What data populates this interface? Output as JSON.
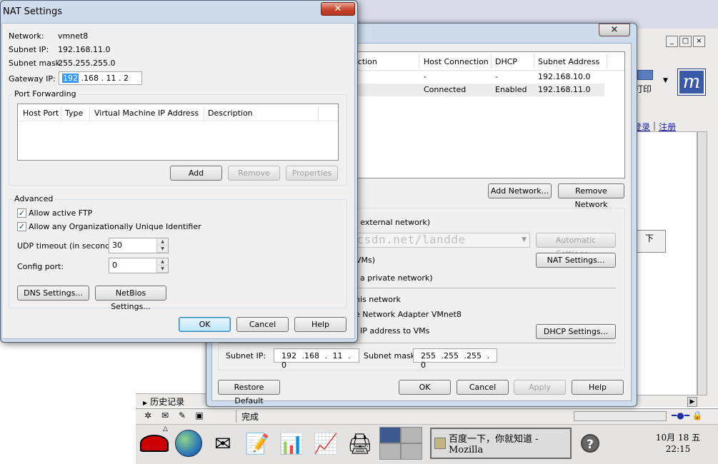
{
  "desktop": {
    "window_controls": [
      "_",
      "□",
      "×"
    ],
    "print_label": "打印",
    "right_links": [
      "登录",
      "注册"
    ],
    "box_text": "下",
    "history_label": "历史记录",
    "status_text": "完成",
    "taskbar_task": "百度一下，你就知道 - Mozilla",
    "clock_date": "10月 18 五",
    "clock_time": "22:15",
    "help_icon": "?"
  },
  "network_editor": {
    "close_glyph": "×",
    "columns": [
      "ection",
      "Host Connection",
      "DHCP",
      "Subnet Address"
    ],
    "rows": [
      {
        "host_connection": "-",
        "dhcp": "-",
        "subnet": "192.168.10.0"
      },
      {
        "host_connection": "Connected",
        "dhcp": "Enabled",
        "subnet": "192.168.11.0"
      }
    ],
    "add_network": "Add Network...",
    "remove_network": "Remove Network",
    "bridged_text": "e external network)",
    "automatic_settings": "Automatic Settings...",
    "nat_text": "VMs)",
    "nat_settings": "NAT Settings...",
    "host_only_text": "a private network)",
    "connect_adapter_text": "his network",
    "adapter_name_text": "e Network Adapter VMnet8",
    "dhcp_text": "IP address to VMs",
    "dhcp_settings": "DHCP Settings...",
    "subnet_ip_label": "Subnet IP:",
    "subnet_ip_value": "192 .168 . 11 . 0",
    "subnet_mask_label": "Subnet mask:",
    "subnet_mask_value": "255 .255 .255 . 0",
    "restore_default": "Restore Default",
    "ok": "OK",
    "cancel": "Cancel",
    "apply": "Apply",
    "help": "Help"
  },
  "watermark": "http://blog.csdn.net/landde",
  "nat_dialog": {
    "title": "NAT Settings",
    "close_glyph": "✕",
    "network_label": "Network:",
    "network_value": "vmnet8",
    "subnet_ip_label": "Subnet IP:",
    "subnet_ip_value": "192.168.11.0",
    "subnet_mask_label": "Subnet mask:",
    "subnet_mask_value": "255.255.255.0",
    "gateway_label": "Gateway IP:",
    "gateway_octet_selected": "192",
    "gateway_rest": " .168 . 11 . 2",
    "port_forwarding_legend": "Port Forwarding",
    "pf_columns": [
      "Host Port",
      "Type",
      "Virtual Machine IP Address",
      "Description"
    ],
    "add": "Add",
    "remove": "Remove",
    "properties": "Properties",
    "advanced_legend": "Advanced",
    "allow_ftp": "Allow active FTP",
    "allow_oui": "Allow any Organizationally Unique Identifier",
    "checkmark": "✓",
    "udp_label": "UDP timeout (in seconds):",
    "udp_value": "30",
    "config_port_label": "Config port:",
    "config_port_value": "0",
    "spin_up": "▲",
    "spin_down": "▼",
    "dns_settings": "DNS Settings...",
    "netbios_settings": "NetBios Settings...",
    "ok": "OK",
    "cancel": "Cancel",
    "help": "Help"
  }
}
